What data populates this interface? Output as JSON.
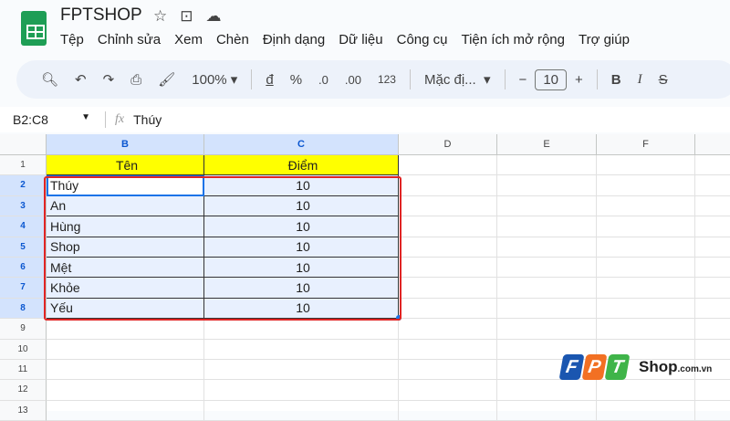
{
  "app": {
    "title": "FPTSHOP"
  },
  "menu": [
    "Tệp",
    "Chỉnh sửa",
    "Xem",
    "Chèn",
    "Định dạng",
    "Dữ liệu",
    "Công cụ",
    "Tiện ích mở rộng",
    "Trợ giúp"
  ],
  "toolbar": {
    "zoom": "100%",
    "currency": "đ",
    "percent": "%",
    "dec_dec": ".0",
    "dec_inc": ".00",
    "number_format": "123",
    "font": "Mặc đị...",
    "font_size": "10",
    "bold": "B",
    "italic": "I"
  },
  "formula_bar": {
    "range": "B2:C8",
    "fx": "fx",
    "value": "Thúy"
  },
  "columns": [
    "B",
    "C",
    "D",
    "E",
    "F"
  ],
  "rows": [
    "1",
    "2",
    "3",
    "4",
    "5",
    "6",
    "7",
    "8",
    "9",
    "10",
    "11",
    "12",
    "13"
  ],
  "headers": {
    "name": "Tên",
    "score": "Điểm"
  },
  "data": [
    [
      "Thúy",
      "10"
    ],
    [
      "An",
      "10"
    ],
    [
      "Hùng",
      "10"
    ],
    [
      "Shop",
      "10"
    ],
    [
      "Mệt",
      "10"
    ],
    [
      "Khỏe",
      "10"
    ],
    [
      "Yếu",
      "10"
    ]
  ],
  "watermark": {
    "letters": [
      "F",
      "P",
      "T"
    ],
    "text": "Shop",
    ".suffix": ".com.vn",
    "suffix": ".com.vn"
  }
}
